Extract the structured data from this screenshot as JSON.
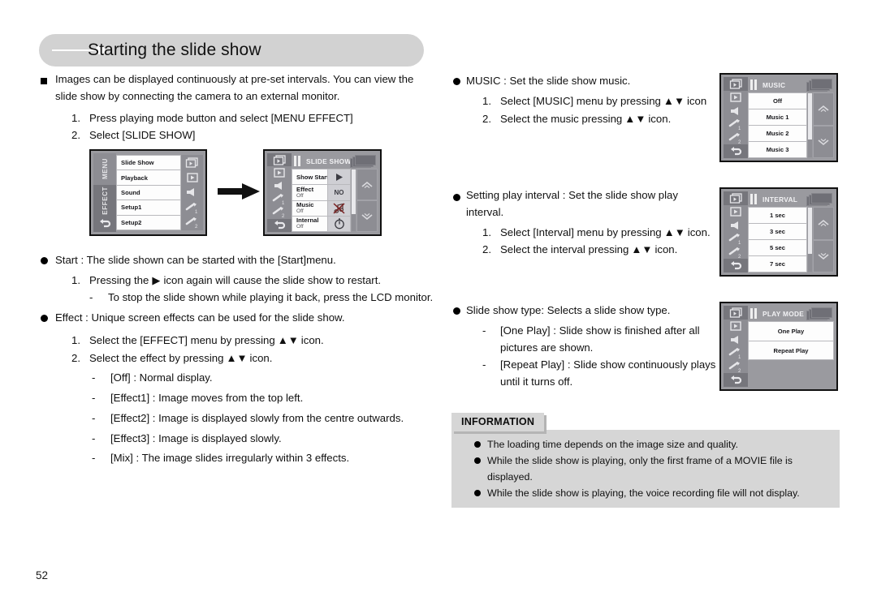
{
  "page": {
    "title": "Starting the slide show",
    "number": "52"
  },
  "left_column": {
    "intro": "Images can be displayed continuously at pre-set intervals. You can view the\nslide show by connecting the camera to an external monitor.",
    "steps": [
      {
        "num": "1.",
        "text": "Press playing mode button and select [MENU EFFECT]"
      },
      {
        "num": "2.",
        "text": "Select [SLIDE SHOW]"
      }
    ],
    "start": {
      "heading": "Start : The slide shown can be started with the [Start]menu.",
      "step1_num": "1.",
      "step1_pre": "Pressing the",
      "step1_post": "icon again will cause the slide show to restart.",
      "sub_dash": "-",
      "sub_text": "To stop the slide shown while playing it back, press the LCD monitor."
    },
    "effect": {
      "heading": "Effect : Unique screen effects can be used for the slide show.",
      "step1_num": "1.",
      "step1_pre": "Select the [EFFECT] menu by pressing",
      "step1_post": "icon.",
      "step2_num": "2.",
      "step2_pre": "Select the effect by pressing",
      "step2_post": "icon.",
      "items": [
        "[Off] : Normal display.",
        "[Effect1] : Image moves from the top left.",
        "[Effect2] : Image is displayed slowly from the centre outwards.",
        "[Effect3] : Image is displayed slowly.",
        "[Mix] : The image slides irregularly within 3 effects."
      ]
    }
  },
  "right_column": {
    "music": {
      "heading": "MUSIC : Set the slide show music.",
      "step1_num": "1.",
      "step1_pre": "Select [MUSIC] menu by pressing",
      "step1_post": "icon",
      "step2_num": "2.",
      "step2_pre": "Select the music pressing",
      "step2_post": "icon."
    },
    "interval": {
      "heading": "Setting play interval : Set the slide show play\ninterval.",
      "step1_num": "1.",
      "step1_pre": "Select [Interval] menu by pressing",
      "step1_post": "icon.",
      "step2_num": "2.",
      "step2_pre": "Select the interval pressing",
      "step2_post": "icon."
    },
    "slideshow_type": {
      "heading": "Slide show type: Selects a slide show type.",
      "items": [
        "[One Play] : Slide show is finished after all\npictures are shown.",
        "[Repeat Play] : Slide show continuously plays\nuntil it turns off."
      ]
    }
  },
  "information": {
    "title": "INFORMATION",
    "items": [
      "The loading time depends on the image size and quality.",
      "While the slide show is playing, only the first frame of a MOVIE file is\ndisplayed.",
      "While the slide show is playing, the voice recording file will not display."
    ]
  },
  "screens": {
    "menu_effect": {
      "side_labels": [
        "MENU",
        "EFFECT"
      ],
      "rows": [
        {
          "label": "Slide Show",
          "icon": "slideshow-icon"
        },
        {
          "label": "Playback",
          "icon": "playback-icon"
        },
        {
          "label": "Sound",
          "icon": "sound-icon"
        },
        {
          "label": "Setup1",
          "icon": "setup1-icon"
        },
        {
          "label": "Setup2",
          "icon": "setup2-icon"
        }
      ]
    },
    "slide_show": {
      "title": "SLIDE SHOW",
      "rows": [
        {
          "label": "Show Start",
          "sub": "",
          "value": "play-icon"
        },
        {
          "label": "Effect",
          "sub": "Off",
          "value": "NO"
        },
        {
          "label": "Music",
          "sub": "Off",
          "value": "music-off-icon"
        },
        {
          "label": "Internal",
          "sub": "Off",
          "value": "clock-icon"
        }
      ]
    },
    "music": {
      "title": "MUSIC",
      "rows": [
        "Off",
        "Music 1",
        "Music 2",
        "Music 3"
      ]
    },
    "interval": {
      "title": "INTERVAL",
      "rows": [
        "1 sec",
        "3 sec",
        "5 sec",
        "7 sec"
      ]
    },
    "play_mode": {
      "title": "PLAY MODE",
      "rows": [
        "One Play",
        "Repeat Play"
      ]
    }
  },
  "colors": {
    "banner": "#d2d2d2",
    "lcd_bg": "#9a9a9f",
    "info_bg": "#d6d6d6"
  }
}
